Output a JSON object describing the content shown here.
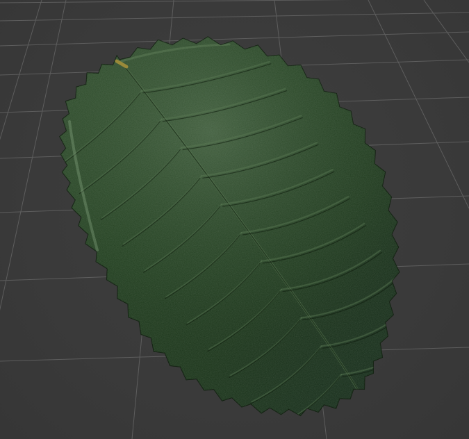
{
  "viewport": {
    "background_color": "#3b3b3b",
    "grid_color": "#6a6a6a",
    "object": {
      "name": "leaf",
      "color_base": "#1f3a1c",
      "color_highlight": "#5a7a55",
      "color_vein": "#2a4a26"
    }
  }
}
